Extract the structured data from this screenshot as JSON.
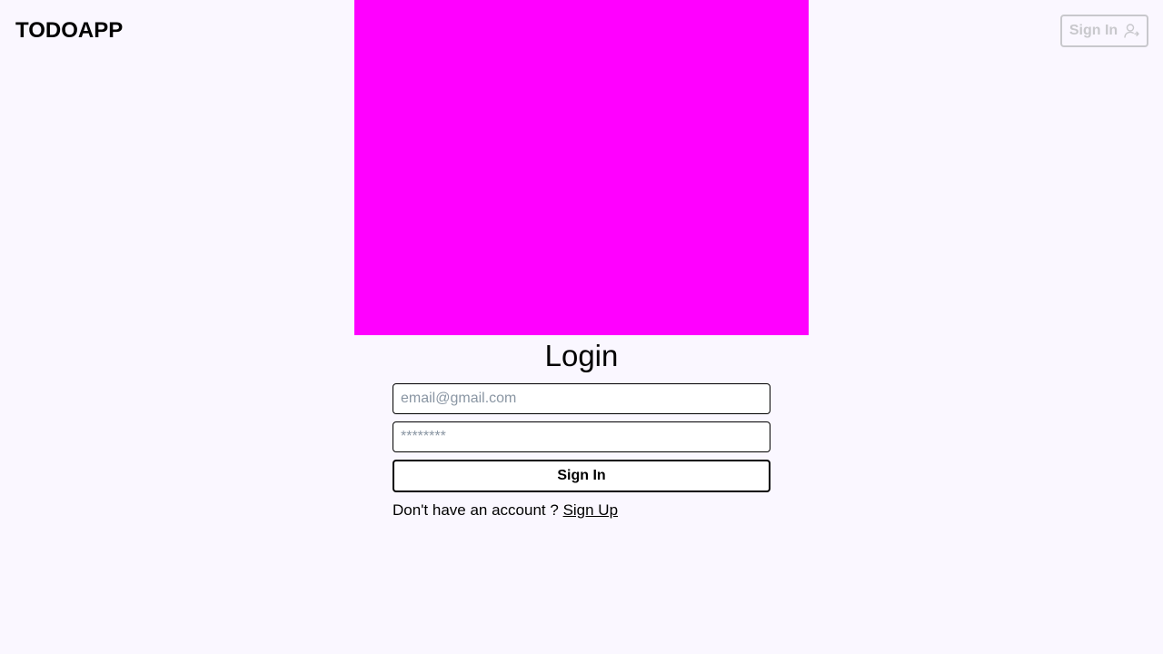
{
  "app": {
    "title": "TODOAPP"
  },
  "header": {
    "signin_label": "Sign In",
    "signin_icon": "user-plus-icon"
  },
  "hero": {
    "color": "#ff00ff"
  },
  "login": {
    "title": "Login",
    "email_placeholder": "email@gmail.com",
    "email_value": "",
    "password_placeholder": "********",
    "password_value": "",
    "submit_label": "Sign In",
    "signup_prompt": "Don't have an account ?",
    "signup_link": "Sign Up"
  },
  "colors": {
    "background": "#faf7ff",
    "muted_button": "#c8c8cc",
    "placeholder": "#8a96a3"
  }
}
